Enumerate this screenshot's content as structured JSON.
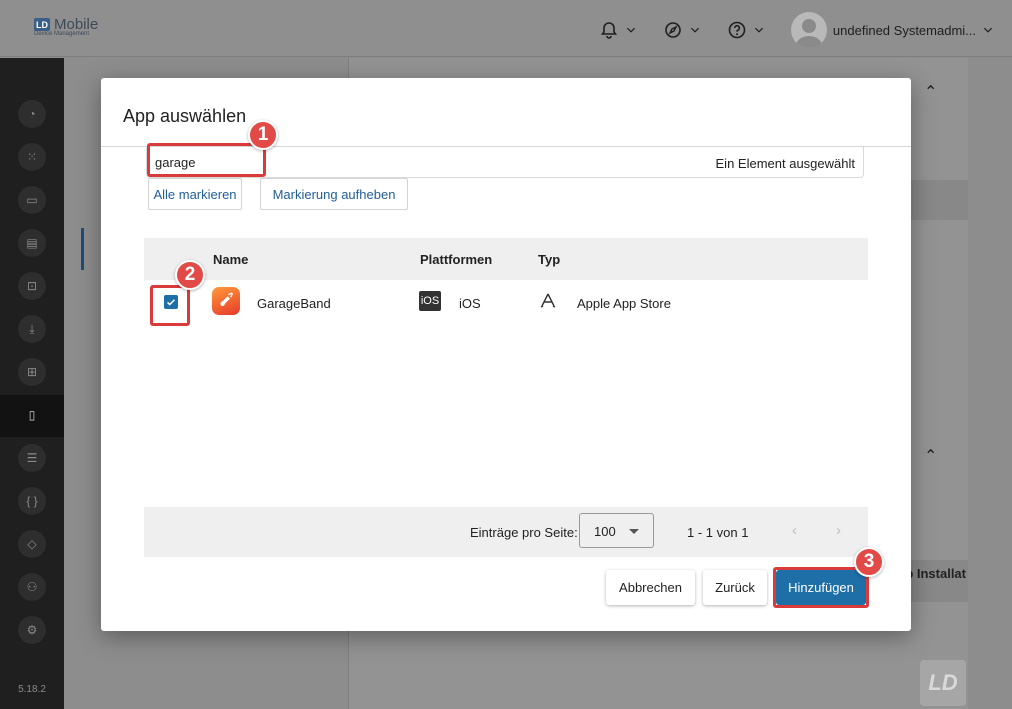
{
  "app": {
    "logo_title": "Mobile",
    "logo_mark": "LD",
    "logo_subtitle": "Device Management",
    "user_name": "undefined Systemadmi...",
    "version": "5.18.2",
    "bg_column_text": "p Installat",
    "watermark": "LD"
  },
  "topbar": {
    "icons": [
      "bell-icon",
      "compass-icon",
      "help-icon"
    ]
  },
  "sidebar": {
    "icons": [
      "dashboard-icon",
      "apps-grid-icon",
      "devices-icon",
      "inventory-icon",
      "remote-icon",
      "download-icon",
      "screen-icon",
      "mobile-device-icon",
      "tasks-icon",
      "code-icon",
      "education-icon",
      "users-icon",
      "settings-icon"
    ]
  },
  "modal": {
    "title": "App auswählen",
    "search": {
      "value": "garage",
      "placeholder": "",
      "status": "Ein Element ausgewählt"
    },
    "select_all_label": "Alle markieren",
    "unselect_label": "Markierung aufheben",
    "table": {
      "columns": [
        "Name",
        "Plattformen",
        "Typ"
      ],
      "rows": [
        {
          "checked": true,
          "name": "GarageBand",
          "platform_badge": "iOS",
          "platform": "iOS",
          "type": "Apple App Store"
        }
      ]
    },
    "pagination": {
      "per_page_label": "Einträge pro Seite:",
      "per_page_value": "100",
      "range": "1 - 1 von 1",
      "prev": "‹",
      "next": "›"
    },
    "buttons": {
      "cancel": "Abbrechen",
      "back": "Zurück",
      "add": "Hinzufügen"
    },
    "markers": [
      "1",
      "2",
      "3"
    ]
  },
  "colors": {
    "primary": "#1e6ea7",
    "highlight": "#d93b3b",
    "marker": "#e14a46"
  }
}
